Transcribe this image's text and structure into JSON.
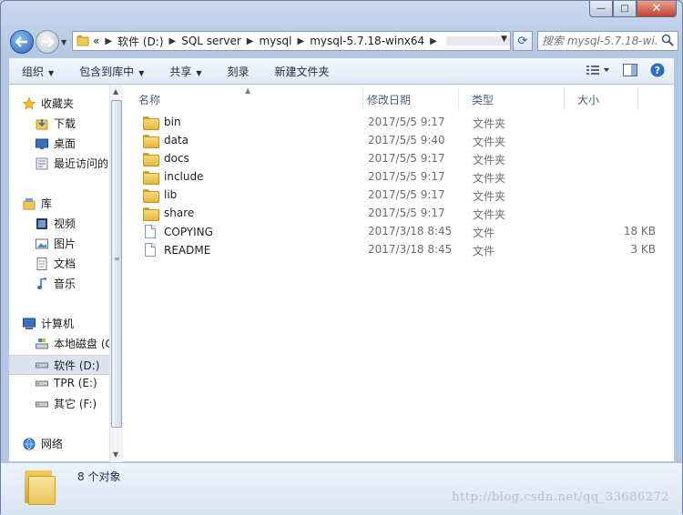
{
  "window": {
    "caption_min": "—",
    "caption_max": "□",
    "caption_close": "✕"
  },
  "address_bar": {
    "overflow": "«",
    "crumbs": [
      "软件 (D:)",
      "SQL server",
      "mysql",
      "mysql-5.7.18-winx64"
    ],
    "search_placeholder": "搜索 mysql-5.7.18-wi..."
  },
  "toolbar": {
    "organize": "组织",
    "include_in_library": "包含到库中",
    "share": "共享",
    "burn": "刻录",
    "new_folder": "新建文件夹"
  },
  "nav": {
    "favorites": "收藏夹",
    "downloads": "下载",
    "desktop": "桌面",
    "recent": "最近访问的",
    "libraries": "库",
    "videos": "视频",
    "pictures": "图片",
    "documents": "文档",
    "music": "音乐",
    "computer": "计算机",
    "local_disk": "本地磁盘 (C",
    "drive_d": "软件 (D:)",
    "drive_e": "TPR (E:)",
    "drive_f": "其它 (F:)",
    "network": "网络"
  },
  "columns": {
    "name": "名称",
    "modified": "修改日期",
    "type": "类型",
    "size": "大小"
  },
  "files": [
    {
      "name": "bin",
      "modified": "2017/5/5 9:17",
      "type": "文件夹",
      "size": "",
      "icon": "folder"
    },
    {
      "name": "data",
      "modified": "2017/5/5 9:40",
      "type": "文件夹",
      "size": "",
      "icon": "folder"
    },
    {
      "name": "docs",
      "modified": "2017/5/5 9:17",
      "type": "文件夹",
      "size": "",
      "icon": "folder"
    },
    {
      "name": "include",
      "modified": "2017/5/5 9:17",
      "type": "文件夹",
      "size": "",
      "icon": "folder"
    },
    {
      "name": "lib",
      "modified": "2017/5/5 9:17",
      "type": "文件夹",
      "size": "",
      "icon": "folder"
    },
    {
      "name": "share",
      "modified": "2017/5/5 9:17",
      "type": "文件夹",
      "size": "",
      "icon": "folder"
    },
    {
      "name": "COPYING",
      "modified": "2017/3/18 8:45",
      "type": "文件",
      "size": "18 KB",
      "icon": "file"
    },
    {
      "name": "README",
      "modified": "2017/3/18 8:45",
      "type": "文件",
      "size": "3 KB",
      "icon": "file"
    }
  ],
  "details": {
    "count": "8 个对象",
    "watermark": "http://blog.csdn.net/qq_33686272"
  }
}
